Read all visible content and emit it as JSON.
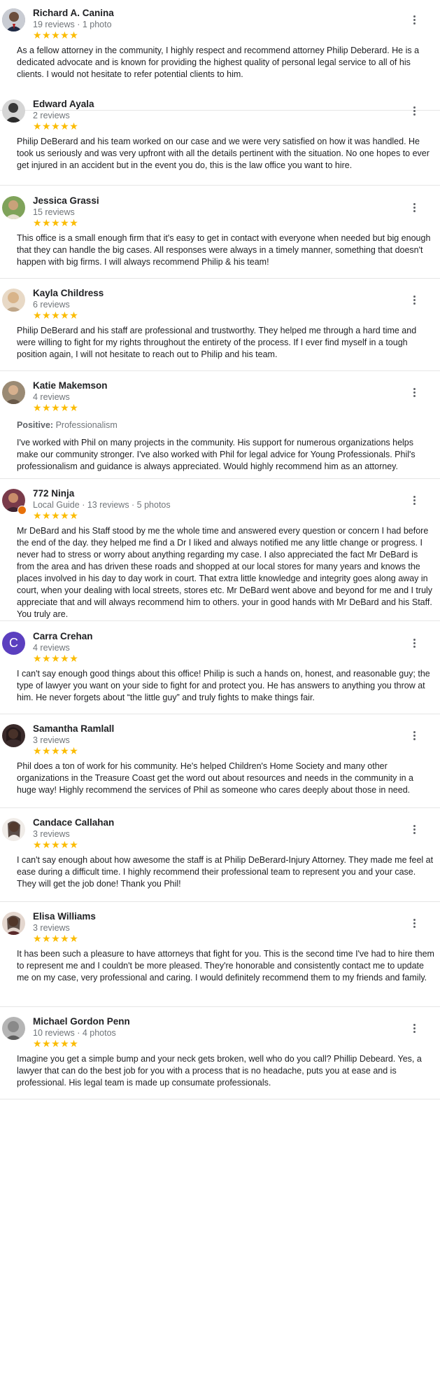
{
  "reviews": [
    {
      "name": "Richard A. Canina",
      "meta": "19 reviews · 1 photo",
      "stars": "★★★★★",
      "text": "As a fellow attorney in the community, I highly respect and recommend attorney Philip Deberard. He is a dedicated advocate and is known for providing the highest quality of personal legal service to all of his clients. I would not hesitate to refer potential clients to him."
    },
    {
      "name": "Edward Ayala",
      "meta": "2 reviews",
      "stars": "★★★★★",
      "text": "Philip DeBerard and his team worked on our case and we were very satisfied on how it was handled. He took us seriously and was very upfront with all the details pertinent with the situation. No one hopes to ever get injured in an accident but in the event you do, this is the law office you want to hire."
    },
    {
      "name": "Jessica Grassi",
      "meta": "15 reviews",
      "stars": "★★★★★",
      "text": "This office is a small enough firm that it's easy to get in contact with everyone when needed but big enough that they can handle the big cases. All responses were always in a timely manner, something that doesn't happen with big firms. I will always recommend Philip & his team!"
    },
    {
      "name": "Kayla Childress",
      "meta": "6 reviews",
      "stars": "★★★★★",
      "text": "Philip DeBerard and his staff are professional and trustworthy. They helped me through a hard time and were willing to fight for my rights throughout the entirety of the process. If I ever find myself in a tough position again, I will not hesitate to reach out to Philip and his team."
    },
    {
      "name": "Katie Makemson",
      "meta": "4 reviews",
      "stars": "★★★★★",
      "positive_label": "Positive:",
      "positive_value": "Professionalism",
      "text": "I've worked with Phil on many projects in the community. His support for numerous organizations helps make our community stronger. I've also worked with Phil for legal advice for Young Professionals. Phil's professionalism and guidance is always appreciated.  Would highly recommend him as an attorney."
    },
    {
      "name": "772 Ninja",
      "meta_guide": "Local Guide",
      "meta": " · 13 reviews · 5 photos",
      "stars": "★★★★★",
      "text": "Mr DeBard and his Staff stood by me the whole time and answered every question or concern I had before the end of the day. they helped me find a Dr I liked and always notified me any little change or progress. I never had to stress or worry about anything regarding my case. I also appreciated the fact Mr DeBard is from the area and has driven these roads and shopped at our local stores for many years and knows the places involved in his day to day work in court. That extra little knowledge and integrity goes along away in court, when your dealing with local streets, stores etc. Mr DeBard went above and beyond for me and I truly appreciate that and will always recommend him to others. your in good hands with Mr DeBard and his Staff. You truly are."
    },
    {
      "name": "Carra Crehan",
      "initial": "C",
      "meta": "4 reviews",
      "stars": "★★★★★",
      "text": "I can't say enough good things about this office! Philip is such a hands on, honest, and reasonable guy; the type of lawyer you want on your side to fight for and protect you. He has answers to anything you throw at him. He never forgets about “the little guy” and truly fights to make things fair."
    },
    {
      "name": "Samantha Ramlall",
      "meta": "3 reviews",
      "stars": "★★★★★",
      "text": "Phil does a ton of work for his community. He's helped Children's Home Society and many other organizations in the Treasure Coast get the word out about resources and needs in the community in a huge way! Highly recommend the services of Phil as someone who cares deeply about those in need."
    },
    {
      "name": "Candace Callahan",
      "meta": "3 reviews",
      "stars": "★★★★★",
      "text": "I can't say enough about how awesome the staff is at Philip DeBerard-Injury Attorney. They made me feel at ease during a difficult time. I highly recommend their professional team to represent you and your case. They will get the job done! Thank you Phil!"
    },
    {
      "name": "Elisa Williams",
      "meta": "3 reviews",
      "stars": "★★★★★",
      "text": "It has been such a pleasure to have attorneys that fight for you. This is the second time I've had to hire them to represent me and I couldn't be more pleased. They're honorable and consistently contact me to update me on my case, very professional and caring. I would definitely recommend them to my friends and family."
    },
    {
      "name": "Michael Gordon Penn",
      "meta": "10 reviews · 4 photos",
      "stars": "★★★★★",
      "text": "Imagine you get a simple bump and your neck gets broken, well who do you call? Phillip Debeard. Yes, a lawyer that can do the best job for you with a process that is no headache, puts you at ease and is professional. His legal team is made up  consumate professionals."
    }
  ],
  "colors": {
    "star": "#fbbc04",
    "meta": "#70757a",
    "divider": "#e6e6e6"
  },
  "icons": {
    "menu": "more-vert-icon",
    "guide_badge": "local-guide-badge-icon"
  }
}
